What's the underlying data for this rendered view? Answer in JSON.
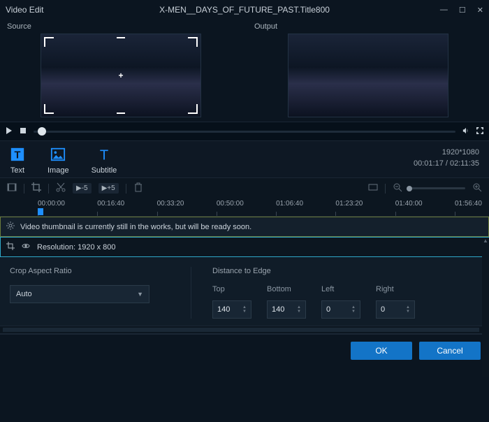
{
  "titlebar": {
    "app": "Video Edit",
    "document": "X-MEN__DAYS_OF_FUTURE_PAST.Title800"
  },
  "preview": {
    "source_label": "Source",
    "output_label": "Output"
  },
  "tools": {
    "text": "Text",
    "image": "Image",
    "subtitle": "Subtitle"
  },
  "info": {
    "resolution": "1920*1080",
    "time": "00:01:17 / 02:11:35"
  },
  "timeline_chips": {
    "back5": "▶-5",
    "fwd5": "▶+5"
  },
  "ruler": [
    "00:00:00",
    "00:16:40",
    "00:33:20",
    "00:50:00",
    "01:06:40",
    "01:23:20",
    "01:40:00",
    "01:56:40"
  ],
  "notice": "Video thumbnail is currently still in the works, but will be ready soon.",
  "resolution_line": "Resolution: 1920 x 800",
  "crop": {
    "section": "Crop Aspect Ratio",
    "value": "Auto"
  },
  "edge": {
    "section": "Distance to Edge",
    "top_label": "Top",
    "bottom_label": "Bottom",
    "left_label": "Left",
    "right_label": "Right",
    "top": "140",
    "bottom": "140",
    "left": "0",
    "right": "0"
  },
  "buttons": {
    "ok": "OK",
    "cancel": "Cancel"
  }
}
